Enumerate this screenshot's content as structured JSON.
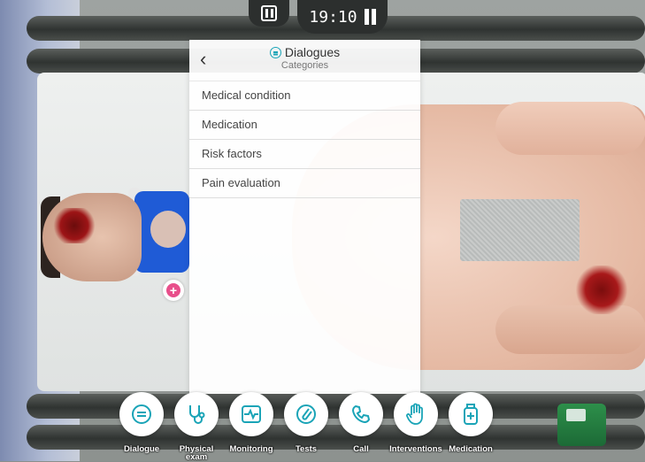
{
  "hud": {
    "timer": "19:10"
  },
  "panel": {
    "title": "Dialogues",
    "subtitle": "Categories",
    "categories": [
      "Medical condition",
      "Medication",
      "Risk factors",
      "Pain evaluation"
    ]
  },
  "toolbar": {
    "items": [
      {
        "label": "Dialogue",
        "icon": "chat-icon"
      },
      {
        "label": "Physical exam",
        "icon": "stethoscope-icon"
      },
      {
        "label": "Monitoring",
        "icon": "heart-monitor-icon"
      },
      {
        "label": "Tests",
        "icon": "test-tube-icon"
      },
      {
        "label": "Call",
        "icon": "phone-icon"
      },
      {
        "label": "Interventions",
        "icon": "hand-icon"
      },
      {
        "label": "Medication",
        "icon": "medicine-bottle-icon"
      }
    ]
  },
  "colors": {
    "accent": "#1aa4b7",
    "add_button": "#e84f8b"
  }
}
